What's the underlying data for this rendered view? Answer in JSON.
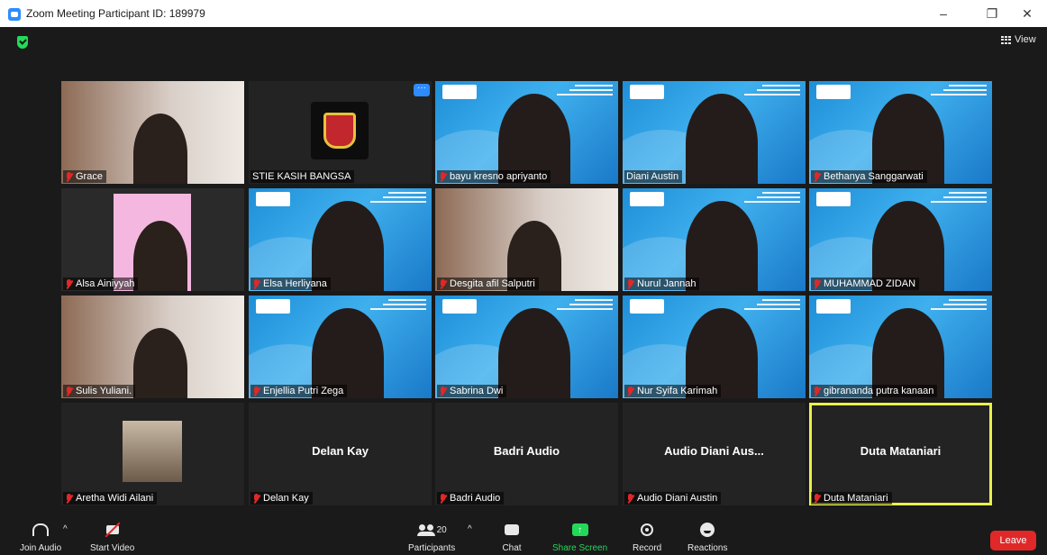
{
  "window": {
    "title": "Zoom Meeting Participant ID: 189979",
    "controls": [
      "–",
      "❐",
      "✕"
    ]
  },
  "meeting": {
    "view_label": "View",
    "tiles": [
      {
        "name": "Grace",
        "muted": true,
        "type": "video"
      },
      {
        "name": "STIE KASIH BANGSA",
        "muted": false,
        "type": "logo"
      },
      {
        "name": "bayu kresno apriyanto",
        "muted": true,
        "type": "vbg"
      },
      {
        "name": "Diani Austin",
        "muted": false,
        "type": "vbg"
      },
      {
        "name": "Bethanya Sanggarwati",
        "muted": true,
        "type": "vbg"
      },
      {
        "name": "Alsa Ainiyyah",
        "muted": true,
        "type": "video"
      },
      {
        "name": "Elsa Herliyana",
        "muted": true,
        "type": "vbg"
      },
      {
        "name": "Desgita afil Salputri",
        "muted": true,
        "type": "video"
      },
      {
        "name": "Nurul Jannah",
        "muted": true,
        "type": "vbg"
      },
      {
        "name": "MUHAMMAD ZIDAN",
        "muted": true,
        "type": "vbg"
      },
      {
        "name": "Sulis Yuliani.",
        "muted": true,
        "type": "video"
      },
      {
        "name": "Enjellia Putri Zega",
        "muted": true,
        "type": "vbg"
      },
      {
        "name": "Sabrina Dwi",
        "muted": true,
        "type": "vbg"
      },
      {
        "name": "Nur Syifa Karimah",
        "muted": true,
        "type": "vbg"
      },
      {
        "name": "gibrananda putra kanaan",
        "muted": true,
        "type": "vbg"
      },
      {
        "name": "Aretha Widi Ailani",
        "muted": true,
        "type": "photo"
      },
      {
        "name": "Delan Kay",
        "muted": true,
        "type": "blank",
        "center": "Delan Kay"
      },
      {
        "name": "Badri Audio",
        "muted": true,
        "type": "blank",
        "center": "Badri Audio"
      },
      {
        "name": "Audio Diani Austin",
        "muted": true,
        "type": "blank",
        "center": "Audio Diani Aus..."
      },
      {
        "name": "Duta Mataniari",
        "muted": true,
        "type": "blank",
        "center": "Duta Mataniari",
        "active": true
      }
    ]
  },
  "toolbar": {
    "join_audio": "Join Audio",
    "start_video": "Start Video",
    "participants": "Participants",
    "participants_count": "20",
    "chat": "Chat",
    "share_screen": "Share Screen",
    "record": "Record",
    "reactions": "Reactions",
    "leave": "Leave"
  },
  "colors": {
    "accent_green": "#23d959",
    "leave_red": "#e02828",
    "active_speaker": "#e9f14a"
  }
}
